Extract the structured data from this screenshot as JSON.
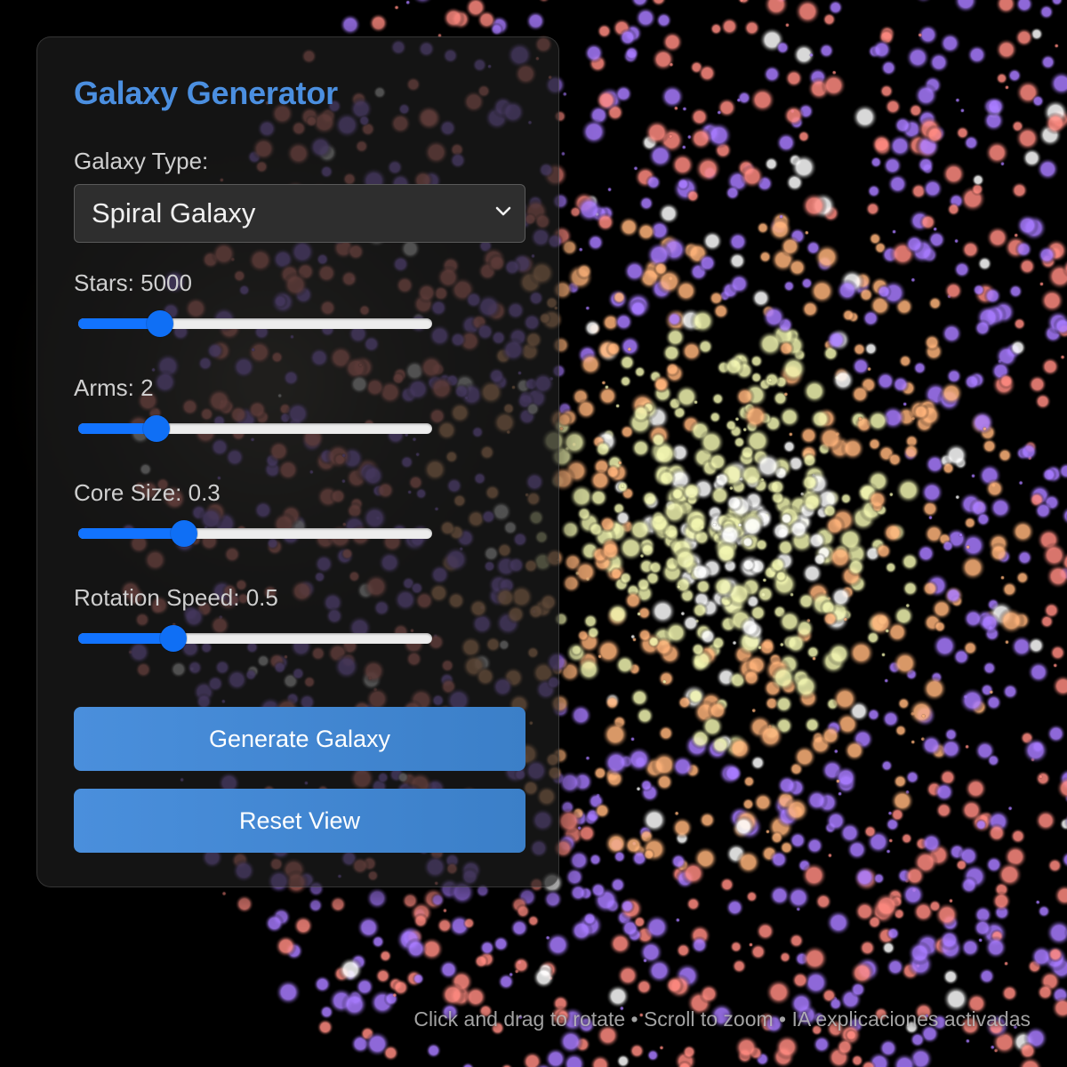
{
  "panel": {
    "title": "Galaxy Generator",
    "galaxy_type": {
      "label": "Galaxy Type:",
      "selected": "Spiral Galaxy"
    },
    "sliders": [
      {
        "label": "Stars: 5000",
        "fraction": 0.23
      },
      {
        "label": "Arms: 2",
        "fraction": 0.22
      },
      {
        "label": "Core Size: 0.3",
        "fraction": 0.3
      },
      {
        "label": "Rotation Speed: 0.5",
        "fraction": 0.27
      }
    ],
    "generate_label": "Generate Galaxy",
    "reset_label": "Reset View"
  },
  "footer": {
    "hint": "Click and drag to rotate • Scroll to zoom • IA explicaciones activadas"
  },
  "colors": {
    "accent": "#4b8fe0",
    "slider_fill": "#1273ff",
    "button": "#4a8fdc",
    "star_palette": [
      "#ff8a80",
      "#a87bff",
      "#ffb37a",
      "#f2f5b0",
      "#ffffff"
    ]
  }
}
